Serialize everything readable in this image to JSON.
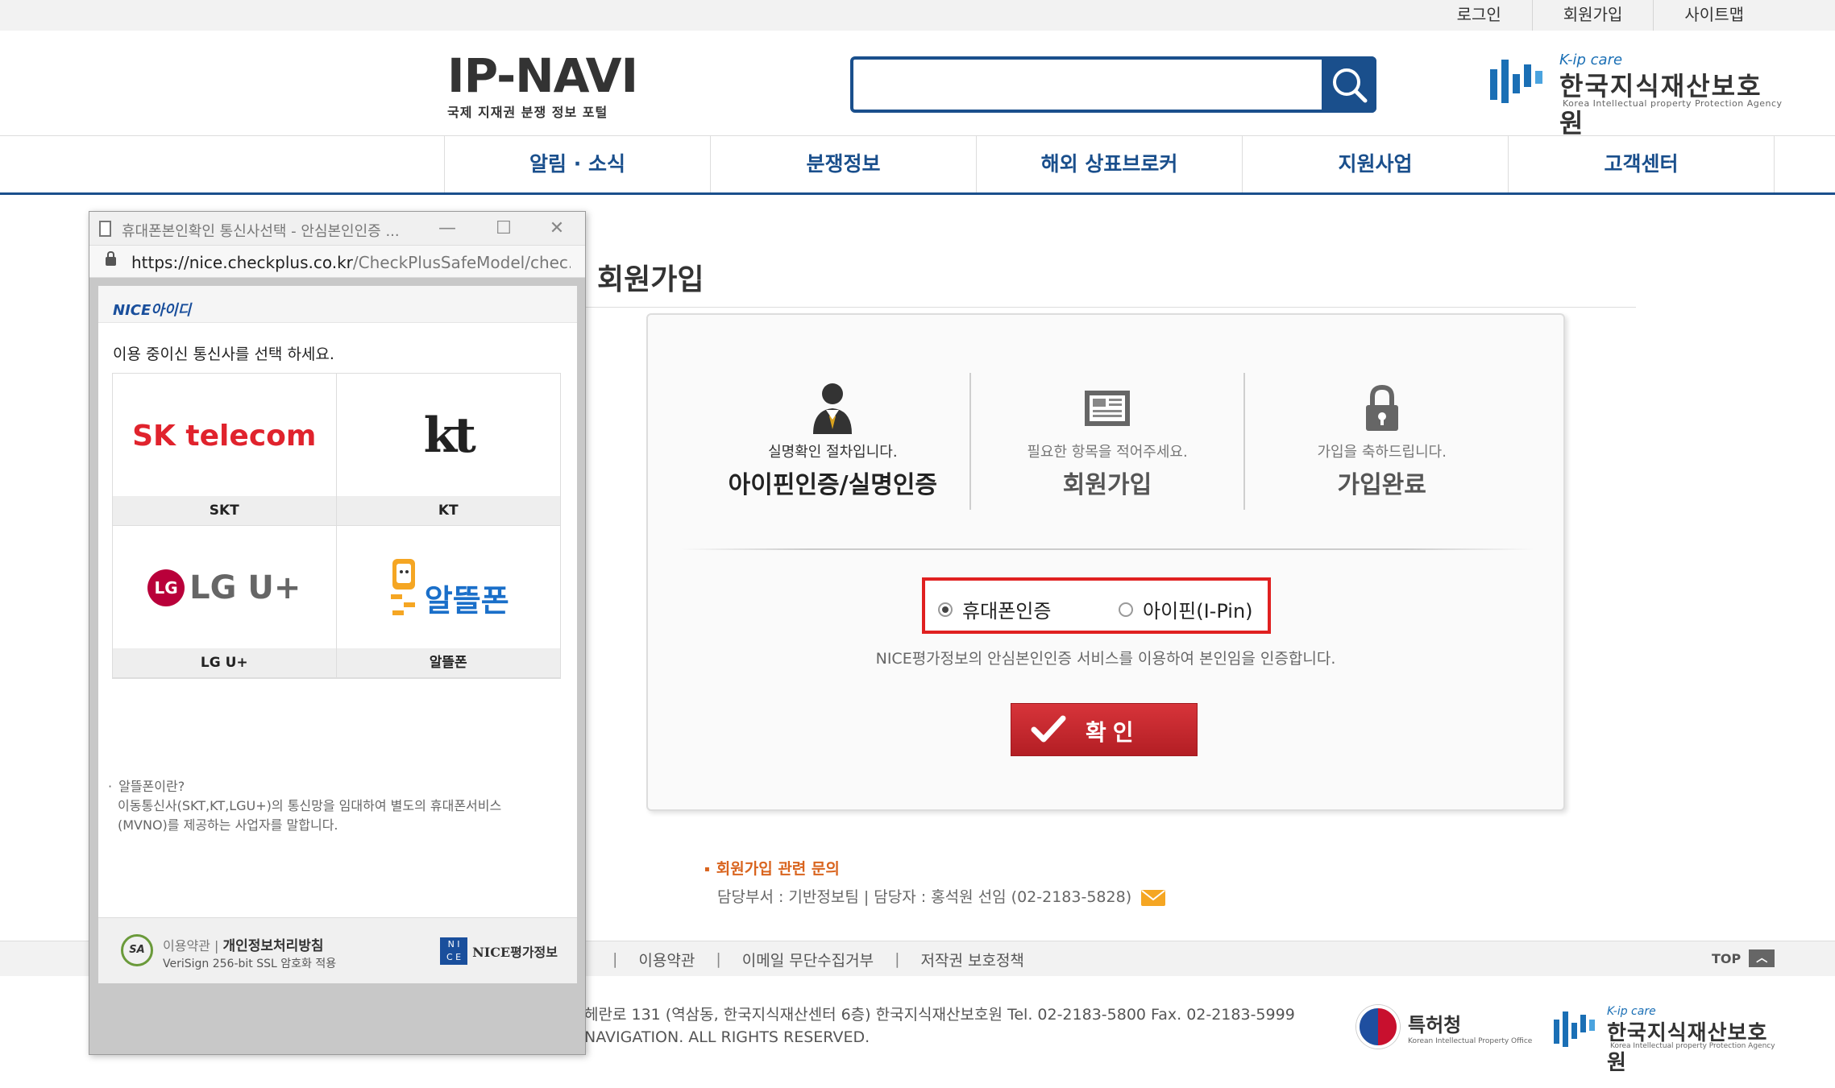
{
  "util": {
    "login": "로그인",
    "join": "회원가입",
    "sitemap": "사이트맵"
  },
  "header": {
    "logo_main": "IP-NAVI",
    "logo_sub": "국제 지재권 분쟁 정보 포털",
    "search_placeholder": "",
    "agency_tag": "K-ip care",
    "agency_name": "한국지식재산보호원",
    "agency_en": "Korea Intellectual property Protection Agency"
  },
  "nav": [
    "알림 · 소식",
    "분쟁정보",
    "해외 상표브로커",
    "지원사업",
    "고객센터"
  ],
  "page_title": "회원가입",
  "steps": [
    {
      "sub": "실명확인 절차입니다.",
      "title": "아이핀인증/실명인증",
      "icon": "person-icon"
    },
    {
      "sub": "필요한 항목을 적어주세요.",
      "title": "회원가입",
      "icon": "form-icon"
    },
    {
      "sub": "가입을 축하드립니다.",
      "title": "가입완료",
      "icon": "lock-icon"
    }
  ],
  "auth": {
    "phone_label": "휴대폰인증",
    "ipin_label": "아이핀(I-Pin)",
    "selected": "phone",
    "description": "NICE평가정보의 안심본인인증 서비스를 이용하여 본인임을 인증합니다.",
    "confirm_label": "확인"
  },
  "inquiry": {
    "title": "회원가입 관련 문의",
    "body": "담당부서 : 기반정보팀 | 담당자 : 홍석원 선임 (02-2183-5828)"
  },
  "footer": {
    "links": [
      "이용약관",
      "이메일 무단수집거부",
      "저작권 보호정책"
    ],
    "top_label": "TOP",
    "address": "헤란로 131 (역삼동, 한국지식재산센터 6층) 한국지식재산보호원 Tel. 02-2183-5800 Fax. 02-2183-5999",
    "copyright": "NAVIGATION. ALL RIGHTS RESERVED.",
    "kipo_name": "특허청",
    "kipo_en": "Korean Intellectual Property Office",
    "agency_tag": "K-ip care",
    "agency_name": "한국지식재산보호원",
    "agency_en": "Korea Intellectual property Protection Agency"
  },
  "popup": {
    "title": "휴대폰본인확인 통신사선택 - 안심본인인증 ...",
    "url_host": "https://nice.checkplus.co.kr",
    "url_path": "/CheckPlusSafeModel/chec...",
    "brand": "NICE아이디",
    "instruction": "이용 중이신 통신사를 선택 하세요.",
    "carriers": [
      {
        "name": "SKT",
        "logo": "SK telecom"
      },
      {
        "name": "KT",
        "logo": "kt"
      },
      {
        "name": "LG U+",
        "logo": "LG U+"
      },
      {
        "name": "알뜰폰",
        "logo": "알뜰폰"
      }
    ],
    "note_q": "알뜰폰이란?",
    "note_a1": "이동통신사(SKT,KT,LGU+)의 통신망을 임대하여 별도의 휴대폰서비스",
    "note_a2": "(MVNO)를 제공하는 사업자를 말합니다.",
    "foot_terms": "이용약관",
    "foot_privacy": "개인정보처리방침",
    "foot_ssl": "VeriSign 256-bit SSL 암호화 적용",
    "nice_label": "NICE평가정보"
  }
}
